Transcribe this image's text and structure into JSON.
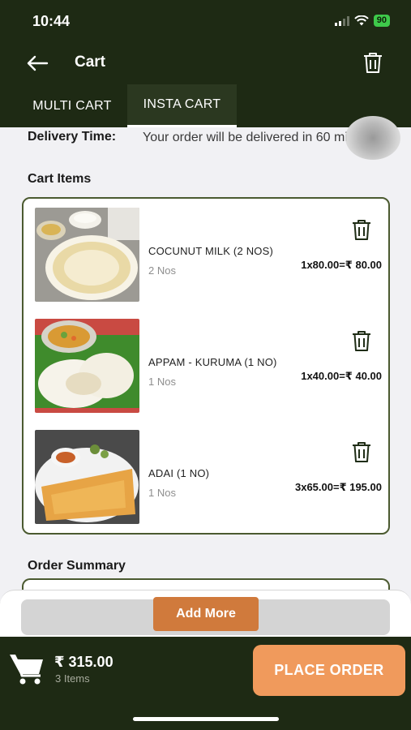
{
  "status_bar": {
    "time": "10:44",
    "battery": "90"
  },
  "header": {
    "title": "Cart",
    "back_icon": "arrow-left-icon",
    "clear_icon": "trash-icon"
  },
  "tabs": [
    {
      "label": "MULTI CART",
      "active": false
    },
    {
      "label": "INSTA CART",
      "active": true
    }
  ],
  "delivery": {
    "label": "Delivery Time:",
    "text": "Your order will be delivered in 60 mins"
  },
  "cart_section_title": "Cart Items",
  "cart_items": [
    {
      "name": "COCUNUT MILK (2 NOS)",
      "qty": "2 Nos",
      "price": "1x80.00=₹ 80.00"
    },
    {
      "name": "APPAM - KURUMA (1 NO)",
      "qty": "1 Nos",
      "price": "1x40.00=₹ 40.00"
    },
    {
      "name": "ADAI (1 NO)",
      "qty": "1 Nos",
      "price": "3x65.00=₹ 195.00"
    }
  ],
  "summary_title": "Order Summary",
  "add_more_label": "Add More",
  "footer": {
    "total": "₹ 315.00",
    "items_count": "3 Items",
    "place_order_label": "PLACE ORDER"
  },
  "colors": {
    "header_bg": "#1e2a14",
    "accent": "#f09a5c",
    "add_more": "#d07a3c",
    "border": "#4b5a30"
  }
}
